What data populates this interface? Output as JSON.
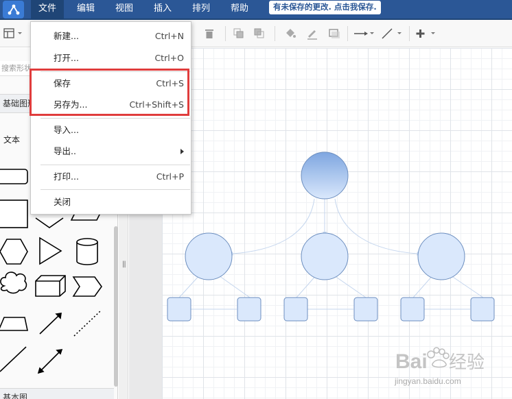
{
  "menubar": {
    "items": [
      "文件",
      "编辑",
      "视图",
      "插入",
      "排列",
      "帮助"
    ],
    "unsaved_notice": "有未保存的更改. 点击我保存."
  },
  "left_panel": {
    "search_placeholder": "搜索形状",
    "section_title": "基础图形",
    "text_shape_label": "文本",
    "bottom_section_title": "基本图"
  },
  "file_menu": {
    "items": [
      {
        "label": "新建...",
        "shortcut": "Ctrl+N"
      },
      {
        "label": "打开...",
        "shortcut": "Ctrl+O"
      },
      {
        "label": "保存",
        "shortcut": "Ctrl+S"
      },
      {
        "label": "另存为...",
        "shortcut": "Ctrl+Shift+S"
      },
      {
        "label": "导入...",
        "shortcut": ""
      },
      {
        "label": "导出..",
        "shortcut": ""
      },
      {
        "label": "打印...",
        "shortcut": "Ctrl+P"
      },
      {
        "label": "关闭",
        "shortcut": ""
      }
    ]
  },
  "toolbar": {
    "icons": [
      "layout-icon",
      "delete-icon",
      "bring-front-icon",
      "send-back-icon",
      "fill-color-icon",
      "line-color-icon",
      "shadow-icon",
      "connector-style-icon",
      "waypoint-style-icon",
      "insert-icon"
    ]
  },
  "watermark": {
    "logo_text": "Bai经验",
    "url_text": "jingyan.baidu.com"
  },
  "colors": {
    "menubar": "#2b5796",
    "highlight": "#e03c3c",
    "node_fill": "#dae8fc",
    "node_stroke": "#6c8ebf"
  }
}
